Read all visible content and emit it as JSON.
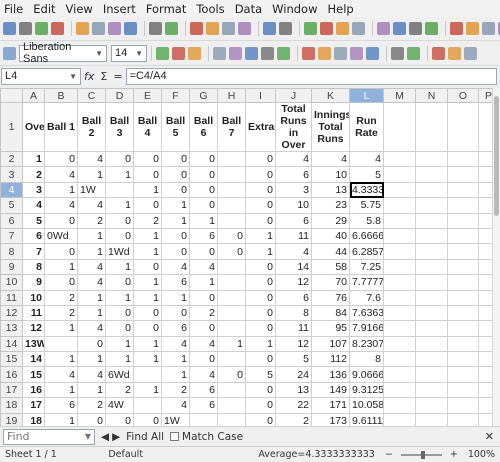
{
  "menu": [
    "File",
    "Edit",
    "View",
    "Insert",
    "Format",
    "Tools",
    "Data",
    "Window",
    "Help"
  ],
  "menu_mnemonics": [
    "F",
    "E",
    "V",
    "I",
    "o",
    "T",
    "D",
    "W",
    "H"
  ],
  "toolbar": {
    "font_name": "Liberation Sans",
    "font_size": "14",
    "icons_row1": [
      "new-icon",
      "open-icon",
      "save-icon",
      "email-icon",
      "edit-icon",
      "export-pdf-icon",
      "print-icon",
      "print-preview-icon",
      "spellcheck-icon",
      "autospell-icon",
      "cut-icon",
      "copy-icon",
      "paste-icon",
      "clone-icon",
      "undo-icon",
      "redo-icon",
      "hyperlink-icon",
      "sort-ascending-icon",
      "sort-descending-icon",
      "autofilter-icon",
      "image-icon",
      "chart-icon",
      "pivot-icon",
      "special-char-icon",
      "navigator-icon",
      "gallery-icon",
      "datasources-icon",
      "help-icon"
    ],
    "icons_row2": [
      "bold-icon",
      "italic-icon",
      "underline-icon",
      "align-left-icon",
      "align-center-icon",
      "align-right-icon",
      "justify-icon",
      "merge-icon",
      "currency-icon",
      "percent-icon",
      "number-icon",
      "add-decimal-icon",
      "delete-decimal-icon",
      "decrease-indent-icon",
      "increase-indent-icon",
      "borders-icon",
      "background-color-icon",
      "font-color-icon"
    ],
    "icon_colors": {
      "accent": "#3c6fb7",
      "green": "#3f9a3a",
      "red": "#c0392b",
      "orange": "#e08a1e"
    }
  },
  "formula_bar": {
    "cell_ref": "L4",
    "buttons": [
      "fx",
      "Σ",
      "="
    ],
    "formula": "=C4/A4"
  },
  "sheet": {
    "columns": [
      "A",
      "B",
      "C",
      "D",
      "E",
      "F",
      "G",
      "H",
      "I",
      "J",
      "K",
      "L",
      "M",
      "N",
      "O",
      "P"
    ],
    "active_column": "L",
    "active_row": 4,
    "header_row": [
      "Overs",
      "Ball 1",
      "Ball 2",
      "Ball 3",
      "Ball 4",
      "Ball 5",
      "Ball 6",
      "Ball 7",
      "Extras",
      "Total Runs in Over",
      "Innings Total Runs",
      "Run Rate",
      "",
      "",
      "",
      ""
    ],
    "rows": [
      [
        "1",
        "0",
        "4",
        "0",
        "0",
        "0",
        "0",
        "",
        "0",
        "4",
        "4",
        "4",
        "",
        "",
        "",
        ""
      ],
      [
        "2",
        "4",
        "1",
        "1",
        "0",
        "0",
        "0",
        "",
        "0",
        "6",
        "10",
        "5",
        "",
        "",
        "",
        ""
      ],
      [
        "3",
        "1",
        "1W",
        "",
        "1",
        "0",
        "0",
        "",
        "0",
        "3",
        "13",
        "4.333333",
        "",
        "",
        "",
        ""
      ],
      [
        "4",
        "4",
        "4",
        "1",
        "0",
        "1",
        "0",
        "",
        "0",
        "10",
        "23",
        "5.75",
        "",
        "",
        "",
        ""
      ],
      [
        "5",
        "0",
        "2",
        "0",
        "2",
        "1",
        "1",
        "",
        "0",
        "6",
        "29",
        "5.8",
        "",
        "",
        "",
        ""
      ],
      [
        "6",
        "0Wd",
        "1",
        "0",
        "1",
        "0",
        "6",
        "0",
        "1",
        "11",
        "40",
        "6.666667",
        "",
        "",
        "",
        ""
      ],
      [
        "7",
        "0",
        "1",
        "1Wd",
        "1",
        "0",
        "0",
        "0",
        "1",
        "4",
        "44",
        "6.285714",
        "",
        "",
        "",
        ""
      ],
      [
        "8",
        "1",
        "4",
        "1",
        "0",
        "4",
        "4",
        "",
        "0",
        "14",
        "58",
        "7.25",
        "",
        "",
        "",
        ""
      ],
      [
        "9",
        "0",
        "4",
        "0",
        "1",
        "6",
        "1",
        "",
        "0",
        "12",
        "70",
        "7.777778",
        "",
        "",
        "",
        ""
      ],
      [
        "10",
        "2",
        "1",
        "1",
        "1",
        "1",
        "0",
        "",
        "0",
        "6",
        "76",
        "7.6",
        "",
        "",
        "",
        ""
      ],
      [
        "11",
        "2",
        "1",
        "0",
        "0",
        "0",
        "2",
        "",
        "0",
        "8",
        "84",
        "7.636364",
        "",
        "",
        "",
        ""
      ],
      [
        "12",
        "1",
        "4",
        "0",
        "0",
        "6",
        "0",
        "",
        "0",
        "11",
        "95",
        "7.916667",
        "",
        "",
        "",
        ""
      ],
      [
        "13Wd",
        "",
        "0",
        "1",
        "1",
        "4",
        "4",
        "1",
        "1",
        "12",
        "107",
        "8.230769",
        "",
        "",
        "",
        ""
      ],
      [
        "14",
        "1",
        "1",
        "1",
        "1",
        "1",
        "0",
        "",
        "0",
        "5",
        "112",
        "8",
        "",
        "",
        "",
        ""
      ],
      [
        "15",
        "4",
        "4",
        "6Wd",
        "",
        "1",
        "4",
        "0",
        "5",
        "24",
        "136",
        "9.066667",
        "",
        "",
        "",
        ""
      ],
      [
        "16",
        "1",
        "1",
        "2",
        "1",
        "2",
        "6",
        "",
        "0",
        "13",
        "149",
        "9.3125",
        "",
        "",
        "",
        ""
      ],
      [
        "17",
        "6",
        "2",
        "4W",
        "",
        "4",
        "6",
        "",
        "0",
        "22",
        "171",
        "10.05882",
        "",
        "",
        "",
        ""
      ],
      [
        "18",
        "1",
        "0",
        "0",
        "0",
        "1W",
        "",
        "",
        "0",
        "2",
        "173",
        "9.611111",
        "",
        "",
        "",
        ""
      ],
      [
        "19",
        "1",
        "1",
        "0",
        "0",
        "2",
        "6",
        "",
        "0",
        "10",
        "183",
        "9.631579",
        "",
        "",
        "",
        ""
      ],
      [
        "20",
        "1",
        "1W",
        "",
        "4Wd",
        "",
        "11B",
        "",
        "0",
        "8",
        "192",
        "9.6",
        "",
        "",
        "",
        ""
      ]
    ],
    "row_numbers": [
      "1",
      "2",
      "3",
      "4",
      "5",
      "6",
      "7",
      "8",
      "9",
      "10",
      "11",
      "12",
      "13",
      "14",
      "15",
      "16",
      "17",
      "18",
      "19",
      "20",
      "21"
    ]
  },
  "find_bar": {
    "placeholder": "Find",
    "find_all": "Find All",
    "match_case": "Match Case",
    "close": "✕"
  },
  "status_bar": {
    "sheet": "Sheet 1 / 1",
    "page_style": "Default",
    "sum": "Average=4.3333333333",
    "zoom": "100%"
  }
}
